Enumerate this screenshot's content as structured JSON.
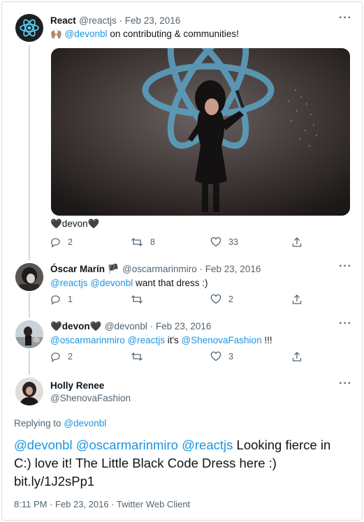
{
  "tweet1": {
    "author_name": "React",
    "handle": "@reactjs",
    "date": "Feb 23, 2016",
    "text_prefix": "🙌🏽 ",
    "mention": "@devonbl",
    "text_suffix": " on contributing & communities!",
    "caption": "🖤devon🖤",
    "replies": "2",
    "retweets": "8",
    "likes": "33"
  },
  "tweet2": {
    "author_name": "Óscar Marín 🏴",
    "handle": "@oscarmarinmiro",
    "date": "Feb 23, 2016",
    "mentions": "@reactjs @devonbl",
    "text": " want that dress :)",
    "replies": "1",
    "retweets": "",
    "likes": "2"
  },
  "tweet3": {
    "author_name": "🖤devon🖤",
    "handle": "@devonbl",
    "date": "Feb 23, 2016",
    "mentions": "@oscarmarinmiro @reactjs",
    "text_mid": " it's ",
    "mention2": "@ShenovaFashion",
    "text_end": " !!!",
    "replies": "2",
    "retweets": "",
    "likes": "3"
  },
  "main": {
    "author_name": "Holly Renee",
    "handle": "@ShenovaFashion",
    "replying_label": "Replying to ",
    "replying_to": "@devonbl",
    "mentions": "@devonbl @oscarmarinmiro @reactjs",
    "text_line1_tail": " Looking fierce in",
    "text_line2": "C:) love it! The Little Black Code Dress here :)",
    "link": "bit.ly/1J2sPp1",
    "timestamp": "8:11 PM · Feb 23, 2016 · Twitter Web Client"
  },
  "more_label": "···",
  "separator": " · ",
  "colors": {
    "link": "#1b95e0",
    "text": "#0f1419",
    "muted": "#536471",
    "react_blue": "#61dafb"
  }
}
